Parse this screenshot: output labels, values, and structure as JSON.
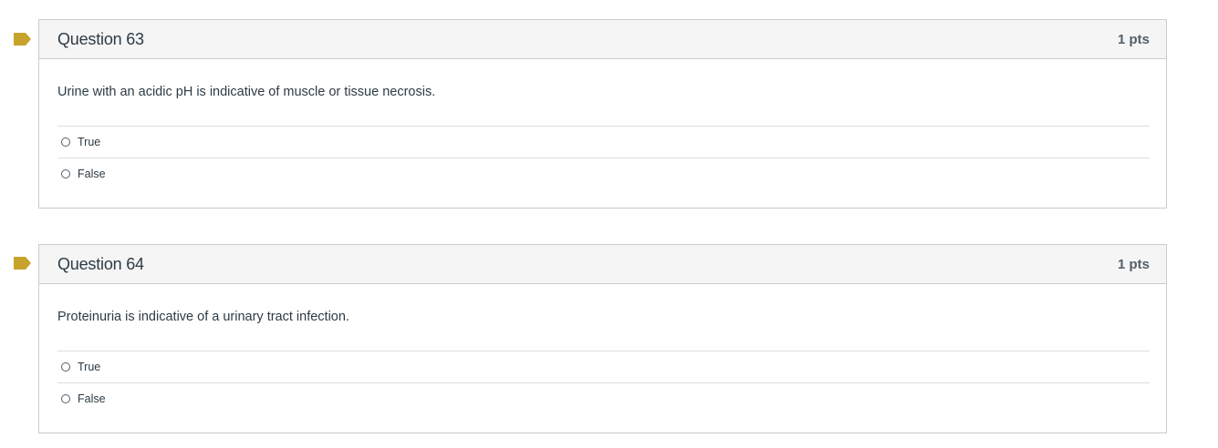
{
  "colors": {
    "flag": "#c8a32b",
    "border": "#c7cdd1",
    "header_bg": "#f5f5f5",
    "text": "#2d3b45"
  },
  "questions": [
    {
      "title": "Question 63",
      "points": "1 pts",
      "text": "Urine with an acidic pH is indicative of muscle or tissue necrosis.",
      "flag_icon": "bookmark-flag-icon",
      "answers": [
        {
          "label": "True",
          "selected": false
        },
        {
          "label": "False",
          "selected": false
        }
      ]
    },
    {
      "title": "Question 64",
      "points": "1 pts",
      "text": "Proteinuria is indicative of a urinary tract infection.",
      "flag_icon": "bookmark-flag-icon",
      "answers": [
        {
          "label": "True",
          "selected": false
        },
        {
          "label": "False",
          "selected": false
        }
      ]
    }
  ]
}
